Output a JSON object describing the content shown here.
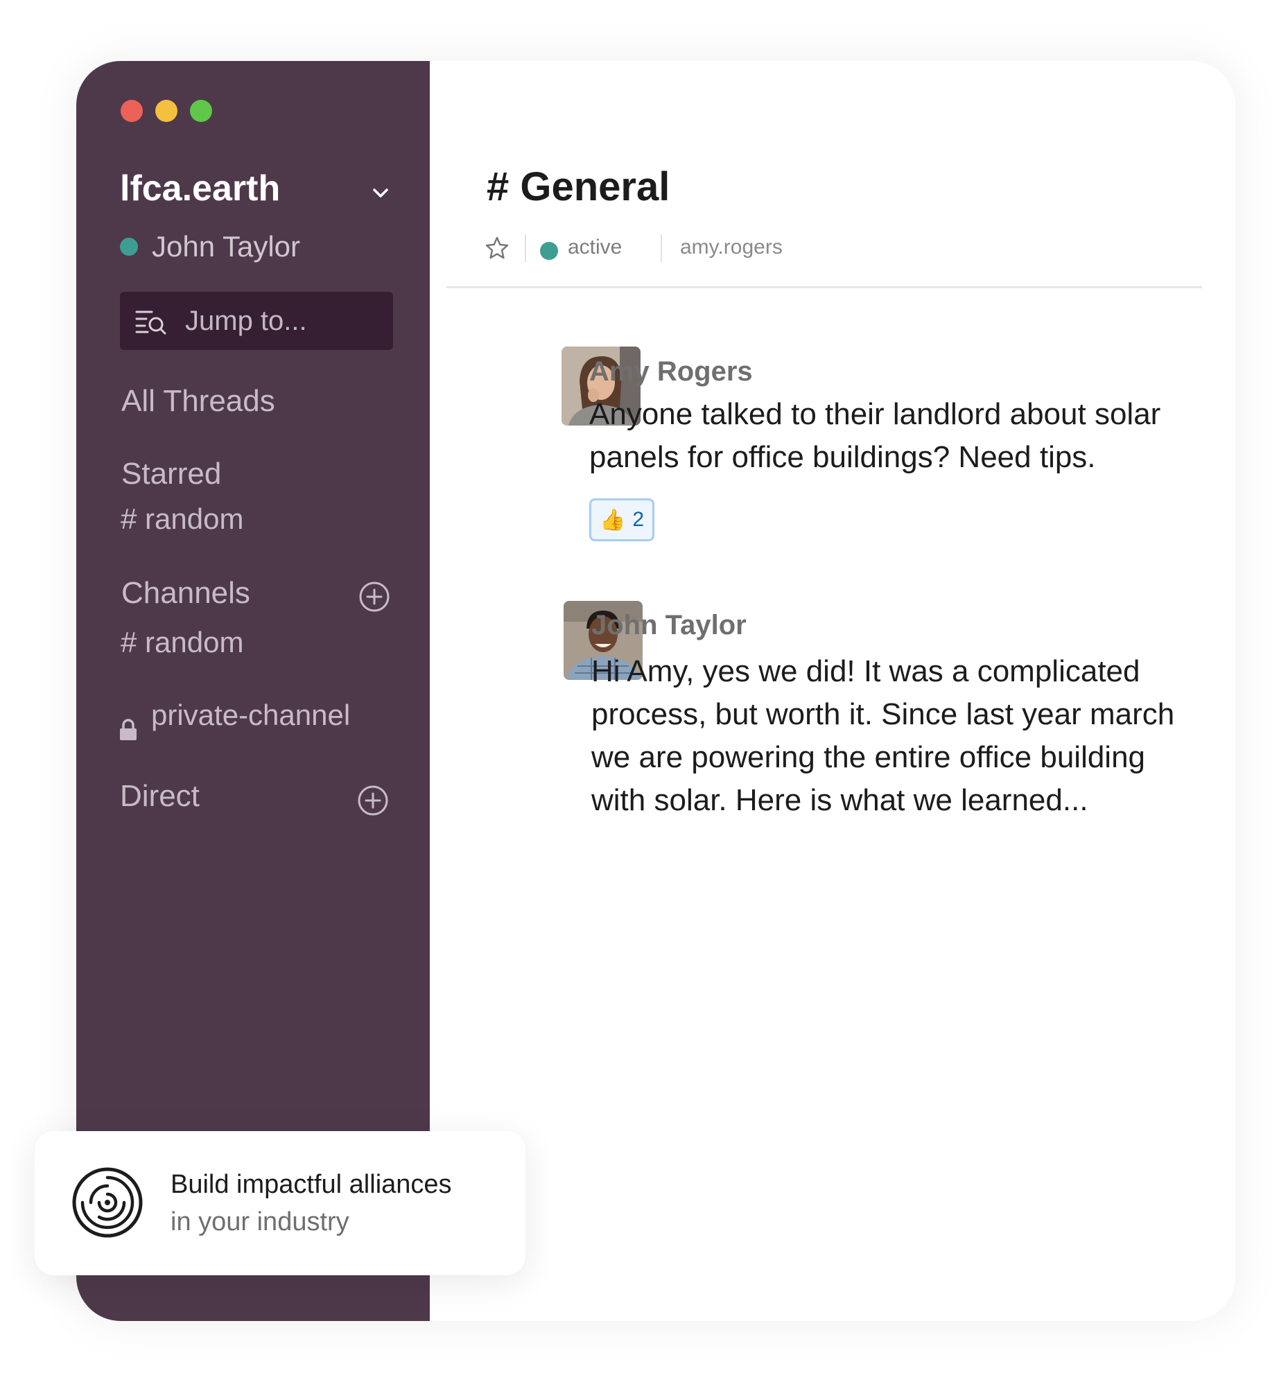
{
  "window": {
    "traffic_lights": {
      "close": "#ec6158",
      "minimize": "#f4c040",
      "maximize": "#5fc84b"
    }
  },
  "sidebar": {
    "background": "#4e394b",
    "workspace_name": "lfca.earth",
    "workspace_icon": "chevron-down-icon",
    "current_user": {
      "name": "John Taylor",
      "presence_color": "#3e9e91"
    },
    "jump_to": {
      "placeholder": "Jump to...",
      "icon": "search-list-icon"
    },
    "all_threads_label": "All Threads",
    "starred": {
      "label": "Starred",
      "items": [
        "# random"
      ]
    },
    "channels": {
      "label": "Channels",
      "add_icon": "add-circle-icon",
      "items": [
        "# random"
      ],
      "private_items": [
        "private-channel"
      ]
    },
    "direct": {
      "label": "Direct",
      "add_icon": "add-circle-icon"
    }
  },
  "channel": {
    "title": "# General",
    "star_icon": "star-icon",
    "status": "active",
    "status_color": "#3e9e91",
    "handle": "amy.rogers"
  },
  "messages": [
    {
      "author": "Amy Rogers",
      "text_lines": [
        "Anyone talked to their landlord about solar",
        "panels for office buildings? Need tips."
      ],
      "reaction": {
        "emoji": "👍",
        "count": "2"
      }
    },
    {
      "author": "John Taylor",
      "text_lines": [
        "Hi Amy, yes we did! It was a complicated",
        "process, but worth it. Since last year march",
        "we are powering the entire office building",
        "with solar. Here is what we learned..."
      ]
    }
  ],
  "promo": {
    "icon": "target-spiral-icon",
    "title": "Build impactful alliances",
    "subtitle": "in your industry"
  }
}
